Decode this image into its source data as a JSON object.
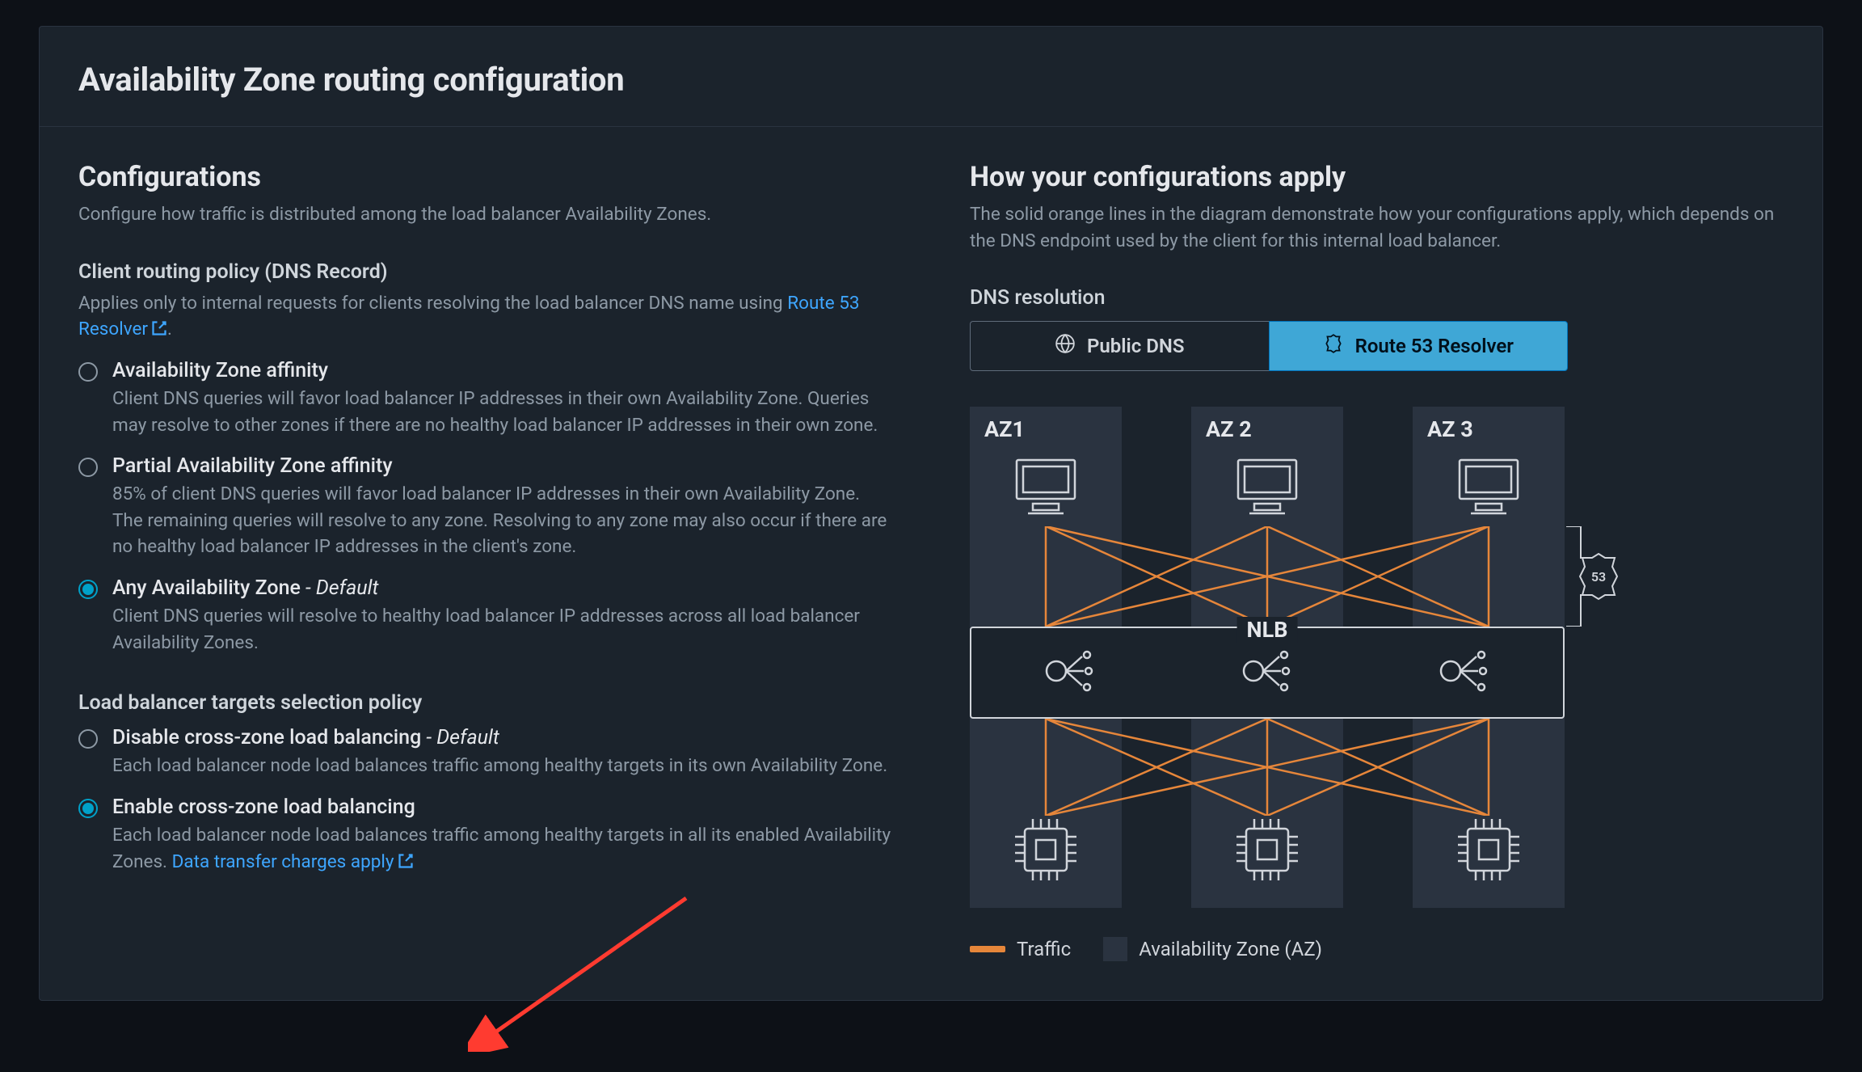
{
  "panel_title": "Availability Zone routing configuration",
  "configs": {
    "heading": "Configurations",
    "subtitle": "Configure how traffic is distributed among the load balancer Availability Zones.",
    "routing_section_label": "Client routing policy (DNS Record)",
    "routing_section_help_a": "Applies only to internal requests for clients resolving the load balancer DNS name using ",
    "routing_link_text": "Route 53 Resolver",
    "routing_section_help_b": ".",
    "routing_options": [
      {
        "label": "Availability Zone affinity",
        "default": false,
        "desc": "Client DNS queries will favor load balancer IP addresses in their own Availability Zone. Queries may resolve to other zones if there are no healthy load balancer IP addresses in their own zone."
      },
      {
        "label": "Partial Availability Zone affinity",
        "default": false,
        "desc": "85% of client DNS queries will favor load balancer IP addresses in their own Availability Zone. The remaining queries will resolve to any zone. Resolving to any zone may also occur if there are no healthy load balancer IP addresses in the client's zone."
      },
      {
        "label": "Any Availability Zone",
        "default": true,
        "desc": "Client DNS queries will resolve to healthy load balancer IP addresses across all load balancer Availability Zones."
      }
    ],
    "routing_selected": 2,
    "targets_section_label": "Load balancer targets selection policy",
    "targets_options": [
      {
        "label": "Disable cross-zone load balancing",
        "default": true,
        "desc": "Each load balancer node load balances traffic among healthy targets in its own Availability Zone."
      },
      {
        "label": "Enable cross-zone load balancing",
        "default": false,
        "desc_a": "Each load balancer node load balances traffic among healthy targets in all its enabled Availability Zones. ",
        "desc_link": "Data transfer charges apply"
      }
    ],
    "targets_selected": 1
  },
  "apply": {
    "heading": "How your configurations apply",
    "subtitle": "The solid orange lines in the diagram demonstrate how your configurations apply, which depends on the DNS endpoint used by the client for this internal load balancer.",
    "dns_label": "DNS resolution",
    "toggle_public": "Public DNS",
    "toggle_r53": "Route 53 Resolver",
    "az_labels": [
      "AZ1",
      "AZ 2",
      "AZ 3"
    ],
    "nlb_label": "NLB",
    "r53_badge": "53",
    "legend_traffic": "Traffic",
    "legend_az": "Availability Zone (AZ)"
  },
  "default_suffix": " - Default",
  "colors": {
    "accent_orange": "#e6863a",
    "accent_blue": "#00a1c9",
    "link_blue": "#3ea6ff"
  }
}
